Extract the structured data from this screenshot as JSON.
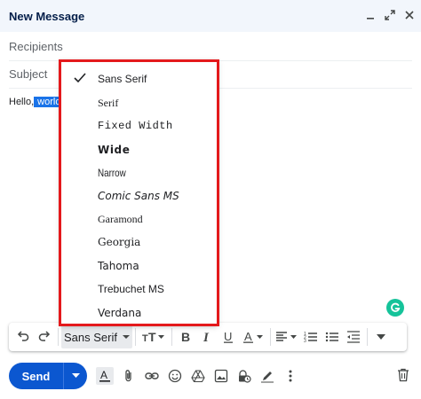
{
  "window": {
    "title": "New Message",
    "controls": [
      "minimize-icon",
      "expand-icon",
      "close-icon"
    ]
  },
  "fields": {
    "recipients_placeholder": "Recipients",
    "subject_placeholder": "Subject"
  },
  "body": {
    "text_before": "Hello,",
    "text_selected": " world"
  },
  "font_menu": {
    "selected": "Sans Serif",
    "items": [
      {
        "label": "Sans Serif"
      },
      {
        "label": "Serif"
      },
      {
        "label": "Fixed Width"
      },
      {
        "label": "Wide"
      },
      {
        "label": "Narrow"
      },
      {
        "label": "Comic Sans MS"
      },
      {
        "label": "Garamond"
      },
      {
        "label": "Georgia"
      },
      {
        "label": "Tahoma"
      },
      {
        "label": "Trebuchet MS"
      },
      {
        "label": "Verdana"
      }
    ]
  },
  "toolbar": {
    "font_label": "Sans Serif",
    "icons": [
      "undo-icon",
      "redo-icon",
      "text-size-icon",
      "bold-icon",
      "italic-icon",
      "underline-icon",
      "text-color-icon",
      "align-icon",
      "numbered-list-icon",
      "bulleted-list-icon",
      "indent-less-icon",
      "more-formatting-icon"
    ]
  },
  "bottom_bar": {
    "send_label": "Send",
    "icons": [
      "formatting-options-icon",
      "attach-icon",
      "link-icon",
      "emoji-icon",
      "drive-icon",
      "photo-icon",
      "confidential-icon",
      "signature-icon",
      "more-options-icon",
      "discard-icon"
    ]
  },
  "colors": {
    "accent": "#0b57d0",
    "header_bg": "#f2f6fc",
    "highlight_outline": "#e4191c",
    "selection": "#1a73e8",
    "grammarly": "#15c39a"
  }
}
